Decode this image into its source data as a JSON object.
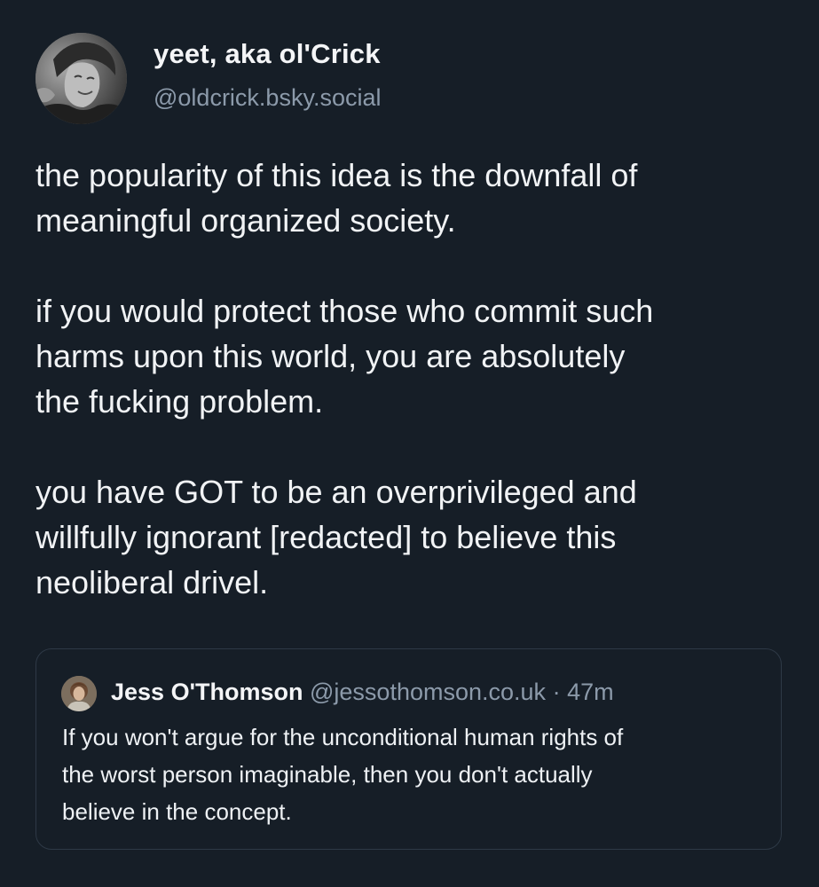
{
  "post": {
    "author": {
      "display_name": "yeet, aka ol'Crick",
      "handle": "@oldcrick.bsky.social",
      "avatar_icon": "profile-photo-avatar"
    },
    "paragraphs": [
      "the popularity of this idea is the downfall of\nmeaningful organized society.",
      "if you would protect those who commit such\nharms upon this world, you are absolutely\nthe fucking problem.",
      "you have GOT to be an overprivileged and\nwillfully ignorant [redacted] to believe this\nneoliberal drivel."
    ]
  },
  "quoted_post": {
    "author": {
      "display_name": "Jess O'Thomson",
      "handle": "@jessothomson.co.uk",
      "avatar_icon": "profile-photo-avatar"
    },
    "separator": "·",
    "time": "47m",
    "text": "If you won't argue for the unconditional human rights of\nthe worst person imaginable, then you don't actually\nbelieve in the concept."
  },
  "colors": {
    "background": "#161e27",
    "text": "#f1f3f5",
    "muted": "#8c9aaa",
    "border": "#2e3946"
  }
}
